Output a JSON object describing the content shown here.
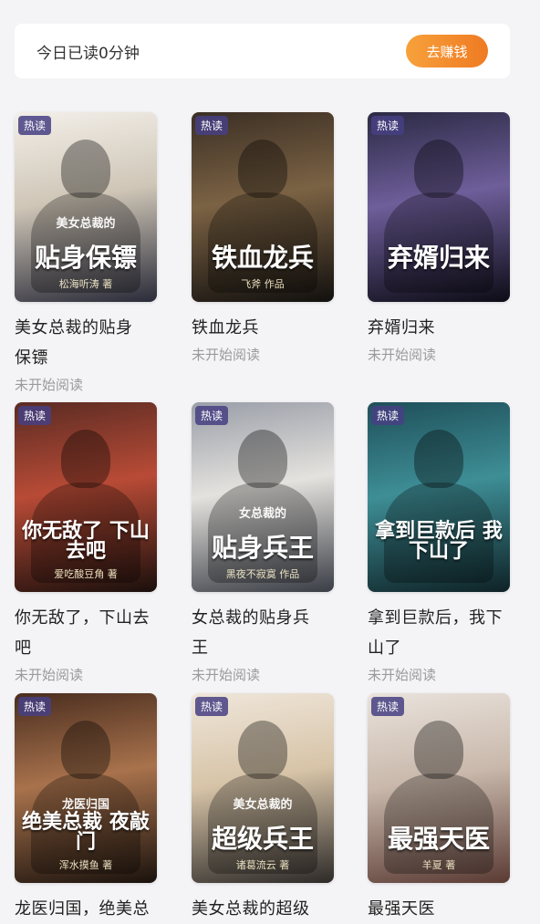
{
  "banner": {
    "reading_text": "今日已读0分钟",
    "earn_button": "去赚钱"
  },
  "badge_label": "热读",
  "books": [
    {
      "title": "美女总裁的贴身\n保镖",
      "cover_text": "贴身保镖",
      "cover_sub": "美女总裁的",
      "cover_author": "松海听涛 著",
      "status": "未开始阅读",
      "palette": [
        "#f3efe9",
        "#cfc6b7",
        "#2a2b39"
      ]
    },
    {
      "title": "铁血龙兵",
      "cover_text": "铁血龙兵",
      "cover_sub": "",
      "cover_author": "飞斧 作品",
      "status": "未开始阅读",
      "palette": [
        "#3b2f24",
        "#7b6244",
        "#12100e"
      ]
    },
    {
      "title": "弃婿归来",
      "cover_text": "弃婿归来",
      "cover_sub": "",
      "cover_author": "",
      "status": "未开始阅读",
      "palette": [
        "#2b2a44",
        "#6e5e9a",
        "#0d0c16"
      ]
    },
    {
      "title": "你无敌了，下山去\n吧",
      "cover_text": "你无敌了 下山去吧",
      "cover_sub": "",
      "cover_author": "爱吃酸豆角 著",
      "status": "未开始阅读",
      "palette": [
        "#5a2b23",
        "#b84b36",
        "#1a0f0c"
      ]
    },
    {
      "title": "女总裁的贴身兵\n王",
      "cover_text": "贴身兵王",
      "cover_sub": "女总裁的",
      "cover_author": "黑夜不寂寞 作品",
      "status": "未开始阅读",
      "palette": [
        "#9a9ea8",
        "#e4e2de",
        "#3a3d45"
      ]
    },
    {
      "title": "拿到巨款后，我下\n山了",
      "cover_text": "拿到巨款后 我下山了",
      "cover_sub": "",
      "cover_author": "",
      "status": "未开始阅读",
      "palette": [
        "#1f4f59",
        "#3e8e96",
        "#0e2226"
      ]
    },
    {
      "title": "龙医归国，绝美总",
      "cover_text": "绝美总裁 夜敲门",
      "cover_sub": "龙医归国",
      "cover_author": "浑水摸鱼 著",
      "status": "",
      "palette": [
        "#4a2d1f",
        "#a8724c",
        "#1a120d"
      ]
    },
    {
      "title": "美女总裁的超级",
      "cover_text": "超级兵王",
      "cover_sub": "美女总裁的",
      "cover_author": "诸葛流云 著",
      "status": "",
      "palette": [
        "#efe6da",
        "#d7c4a8",
        "#2d2a28"
      ]
    },
    {
      "title": "最强天医",
      "cover_text": "最强天医",
      "cover_sub": "",
      "cover_author": "羊夏 著",
      "status": "",
      "palette": [
        "#e9e3dc",
        "#c9b8ab",
        "#5a3b34"
      ]
    }
  ]
}
